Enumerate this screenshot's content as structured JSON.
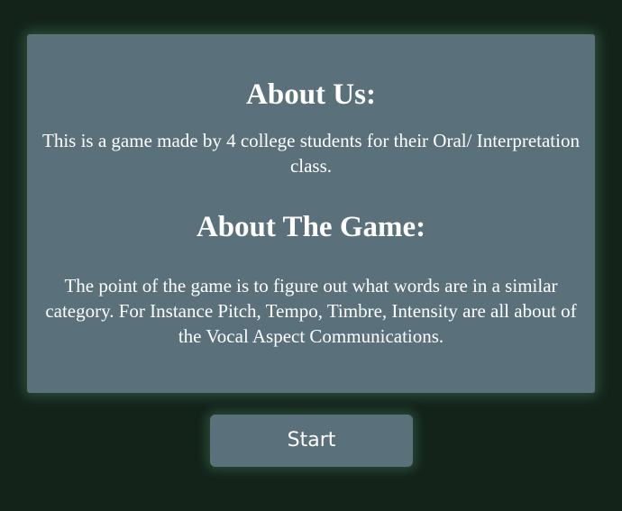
{
  "about": {
    "us_heading": "About Us:",
    "us_text": "This is a game made by 4 college students for their Oral/ Interpretation class.",
    "game_heading": "About The Game:",
    "game_text": "The point of the game is to figure out what words are in a similar category. For Instance Pitch, Tempo, Timbre, Intensity are all about of the Vocal Aspect Communications."
  },
  "start_button": {
    "label": "Start"
  },
  "colors": {
    "background": "#13231a",
    "panel": "#5a717c",
    "text": "#ffffff",
    "glow": "#6ebe8c"
  }
}
